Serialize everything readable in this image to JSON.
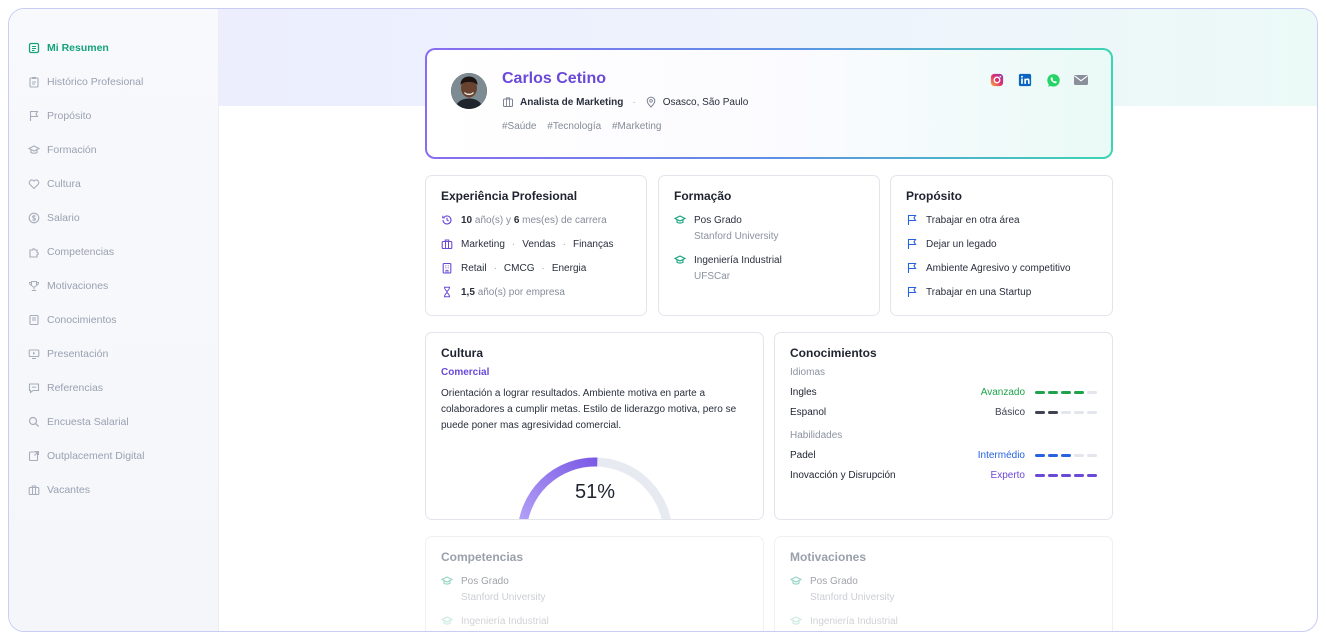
{
  "sidebar": {
    "items": [
      {
        "label": "Mi Resumen",
        "icon": "summary-icon",
        "active": true
      },
      {
        "label": "Histórico Profesional",
        "icon": "clipboard-icon"
      },
      {
        "label": "Propósito",
        "icon": "flag-icon"
      },
      {
        "label": "Formación",
        "icon": "graduation-cap-icon"
      },
      {
        "label": "Cultura",
        "icon": "heart-icon"
      },
      {
        "label": "Salario",
        "icon": "dollar-icon"
      },
      {
        "label": "Competencias",
        "icon": "puzzle-icon"
      },
      {
        "label": "Motivaciones",
        "icon": "trophy-icon"
      },
      {
        "label": "Conocimientos",
        "icon": "book-icon"
      },
      {
        "label": "Presentación",
        "icon": "presentation-icon"
      },
      {
        "label": "Referencias",
        "icon": "message-icon"
      },
      {
        "label": "Encuesta Salarial",
        "icon": "search-icon"
      },
      {
        "label": "Outplacement Digital",
        "icon": "outplacement-icon"
      },
      {
        "label": "Vacantes",
        "icon": "briefcase-icon"
      }
    ]
  },
  "profile": {
    "name": "Carlos Cetino",
    "role": "Analista de Marketing",
    "location": "Osasco, São Paulo",
    "tags": [
      "#Saúde",
      "#Tecnología",
      "#Marketing"
    ],
    "socials": [
      "instagram-icon",
      "linkedin-icon",
      "whatsapp-icon",
      "email-icon"
    ]
  },
  "experience": {
    "title": "Experiência Profesional",
    "years": "10",
    "years_label": "año(s) y",
    "months": "6",
    "months_label": "mes(es) de carrera",
    "areas": [
      "Marketing",
      "Vendas",
      "Finanças"
    ],
    "industries": [
      "Retail",
      "CMCG",
      "Energia"
    ],
    "avg": "1,5",
    "avg_label": "año(s) por empresa"
  },
  "formacion": {
    "title": "Formação",
    "items": [
      {
        "degree": "Pos Grado",
        "school": "Stanford University"
      },
      {
        "degree": "Ingeniería Industrial",
        "school": "UFSCar"
      }
    ]
  },
  "proposito": {
    "title": "Propósito",
    "items": [
      "Trabajar en otra área",
      "Dejar un legado",
      "Ambiente Agresivo y competitivo",
      "Trabajar en una Startup"
    ]
  },
  "cultura": {
    "title": "Cultura",
    "subtitle": "Comercial",
    "text": "Orientación a lograr resultados. Ambiente motiva en parte a colaboradores a cumplir metas. Estilo de liderazgo motiva, pero se puede poner mas agresividad comercial.",
    "percent_label": "51%",
    "percent": 0.51
  },
  "conocimientos": {
    "title": "Conocimientos",
    "idiomas_label": "Idiomas",
    "habilidades_label": "Habilidades",
    "idiomas": [
      {
        "name": "Ingles",
        "level": "Avanzado",
        "score": 4,
        "color": "#1fa34a"
      },
      {
        "name": "Espanol",
        "level": "Básico",
        "score": 2,
        "color": "#3f4352"
      }
    ],
    "habilidades": [
      {
        "name": "Padel",
        "level": "Intermédio",
        "score": 3,
        "color": "#2762e0"
      },
      {
        "name": "Inovacción y Disrupción",
        "level": "Experto",
        "score": 5,
        "color": "#6a49d8"
      }
    ]
  },
  "competencias": {
    "title": "Competencias",
    "items": [
      {
        "degree": "Pos Grado",
        "school": "Stanford University"
      },
      {
        "degree": "Ingeniería Industrial"
      }
    ]
  },
  "motivaciones": {
    "title": "Motivaciones",
    "items": [
      {
        "degree": "Pos Grado",
        "school": "Stanford University"
      },
      {
        "degree": "Ingeniería Industrial"
      }
    ]
  },
  "colors": {
    "accent_green": "#14a37b",
    "accent_purple": "#6a49d8",
    "accent_blue": "#2762e0"
  }
}
